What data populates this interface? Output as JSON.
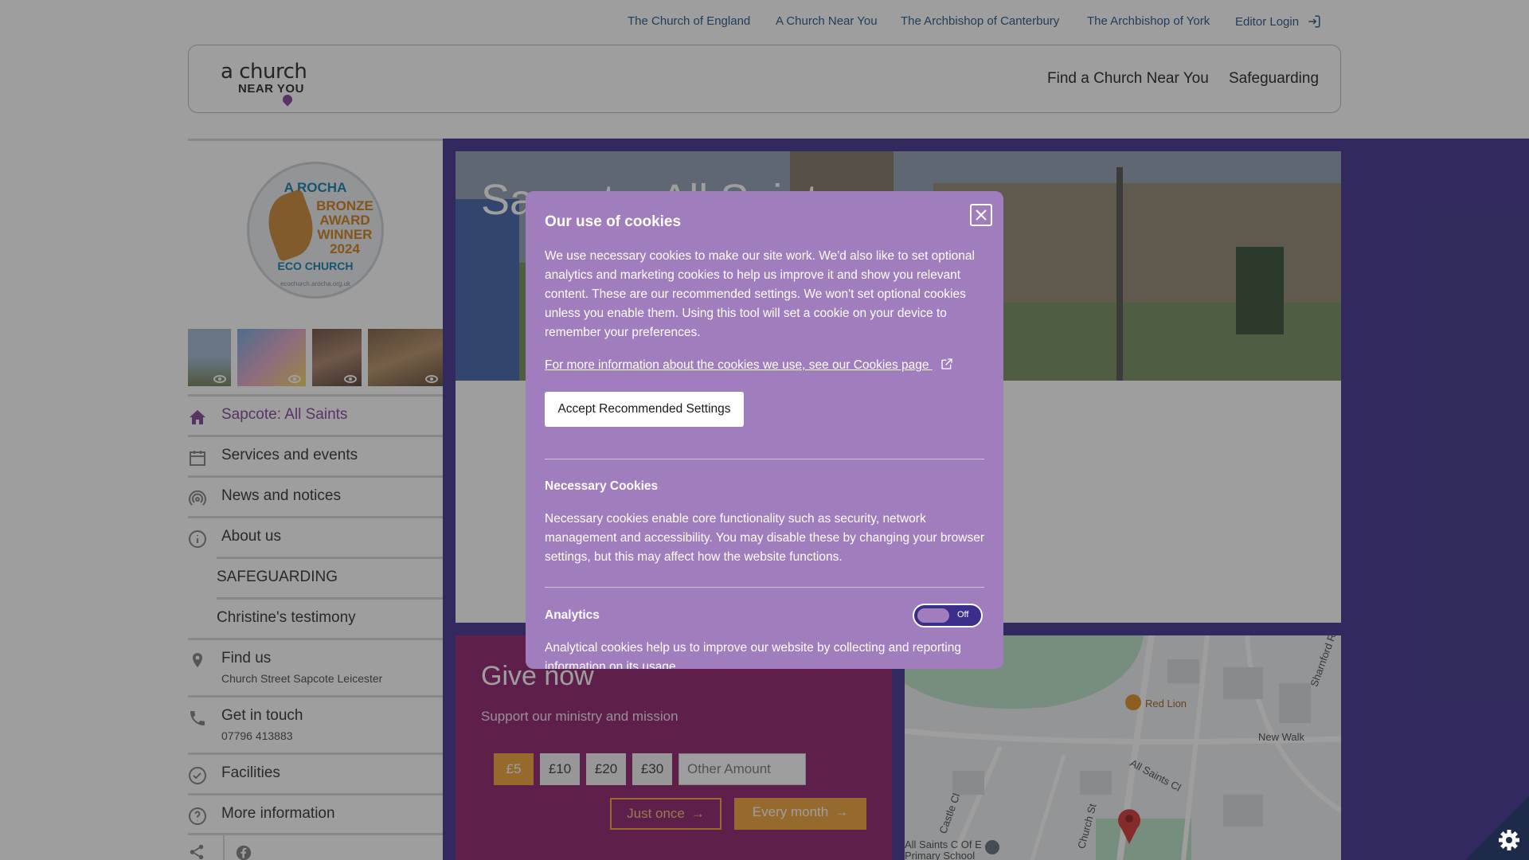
{
  "utility_nav": {
    "links": [
      "The Church of England",
      "A Church Near You",
      "The Archbishop of Canterbury",
      "The Archbishop of York"
    ],
    "editor_login": "Editor Login"
  },
  "header": {
    "logo_line1": "a church",
    "logo_line2": "NEAR YOU",
    "nav": [
      "Find a Church Near You",
      "Safeguarding"
    ]
  },
  "badge": {
    "title": "A ROCHA",
    "award": "BRONZE AWARD WINNER 2024",
    "eco": "ECO CHURCH",
    "url": "ecochurch.arocha.org.uk"
  },
  "sidebar": {
    "items": [
      {
        "label": "Sapcote: All Saints",
        "icon": "home-icon"
      },
      {
        "label": "Services and events",
        "icon": "calendar-icon"
      },
      {
        "label": "News and notices",
        "icon": "broadcast-icon"
      },
      {
        "label": "About us",
        "icon": "info-icon"
      },
      {
        "label": "SAFEGUARDING"
      },
      {
        "label": "Christine's testimony"
      },
      {
        "label": "Find us",
        "sub": "Church Street Sapcote Leicester",
        "icon": "pin-icon"
      },
      {
        "label": "Get in touch",
        "sub": "07796 413883",
        "icon": "phone-icon"
      },
      {
        "label": "Facilities",
        "icon": "check-circle-icon"
      },
      {
        "label": "More information",
        "icon": "question-icon"
      }
    ]
  },
  "hero": {
    "title": "Sapcote: All Saints"
  },
  "give": {
    "title": "Give now",
    "subtitle": "Support our ministry and mission",
    "amounts": [
      "£5",
      "£10",
      "£20",
      "£30"
    ],
    "selected_amount": "£5",
    "other_placeholder": "Other Amount",
    "just_once": "Just once",
    "every_month": "Every month"
  },
  "map": {
    "labels": [
      "Red Lion",
      "New Walk",
      "All Saints Cl",
      "Sharnford Rd",
      "Castle Cl",
      "Church St",
      "All Saints C Of E Primary School"
    ]
  },
  "cookie_modal": {
    "title": "Our use of cookies",
    "intro": "We use necessary cookies to make our site work. We'd also like to set optional analytics and marketing cookies to help us improve it and show you relevant content. These are our recommended settings. We won't set optional cookies unless you enable them. Using this tool will set a cookie on your device to remember your preferences.",
    "more_info_link": "For more information about the cookies we use, see our Cookies page",
    "accept_button": "Accept Recommended Settings",
    "necessary_title": "Necessary Cookies",
    "necessary_text": "Necessary cookies enable core functionality such as security, network management and accessibility. You may disable these by changing your browser settings, but this may affect how the website functions.",
    "analytics_title": "Analytics",
    "analytics_toggle": "Off",
    "analytics_text": "Analytical cookies help us to improve our website by collecting and reporting information on its usage."
  },
  "colors": {
    "purple_dark": "#3b2d8a",
    "give_bg": "#8a1a66",
    "accent_orange": "#f0a030",
    "modal_bg": "#a07dbd",
    "link_blue": "#1d4e89"
  }
}
